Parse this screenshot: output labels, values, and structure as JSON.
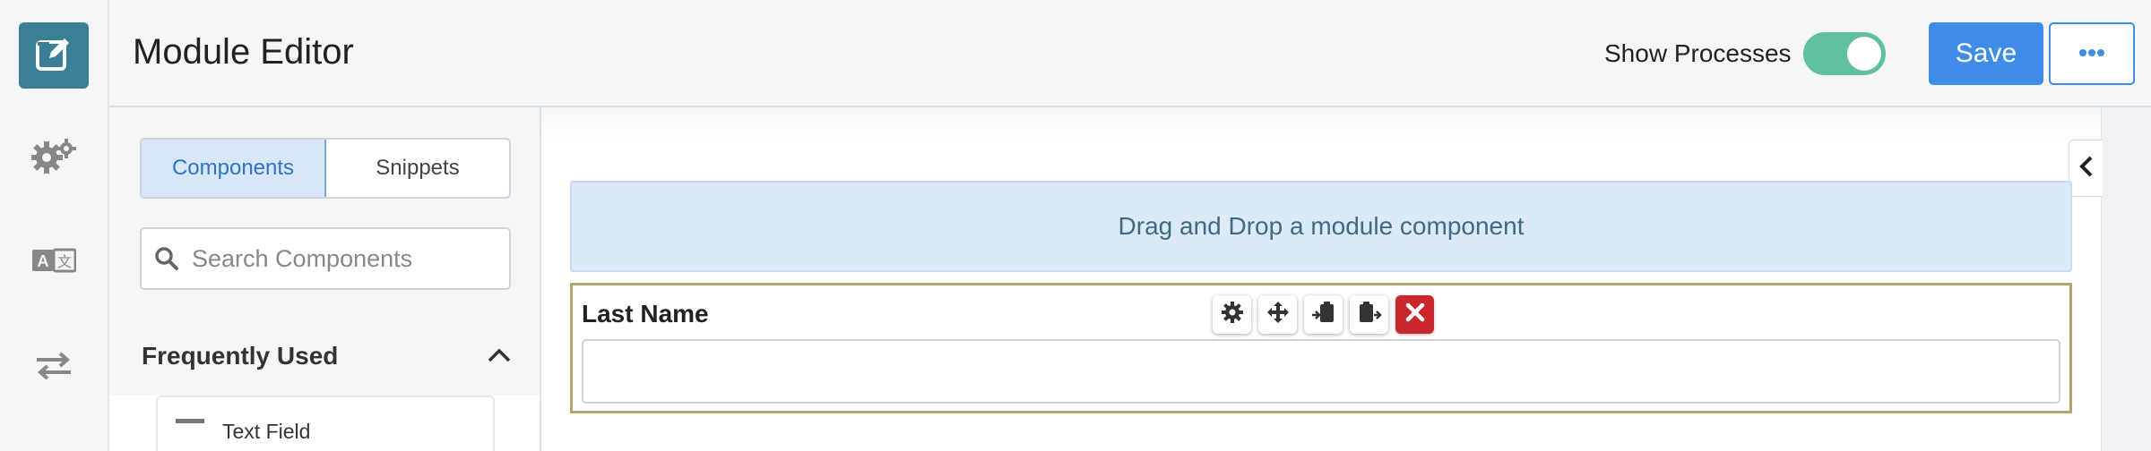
{
  "header": {
    "title": "Module Editor",
    "show_processes_label": "Show Processes",
    "show_processes_on": true,
    "save_label": "Save"
  },
  "rail": {
    "items": [
      {
        "icon": "edit-icon",
        "active": true
      },
      {
        "icon": "gears-icon"
      },
      {
        "icon": "translate-icon"
      },
      {
        "icon": "swap-arrows-icon"
      }
    ]
  },
  "panel": {
    "tabs": [
      {
        "label": "Components",
        "active": true
      },
      {
        "label": "Snippets"
      }
    ],
    "search_placeholder": "Search Components",
    "section_title": "Frequently Used",
    "items": [
      {
        "label": "Text Field",
        "icon": "dash-icon"
      }
    ]
  },
  "canvas": {
    "dropzone_text": "Drag and Drop a module component",
    "field": {
      "label": "Last Name",
      "value": ""
    },
    "field_toolbar": [
      "gear-icon",
      "move-icon",
      "paste-before-icon",
      "paste-after-icon",
      "delete-icon"
    ]
  },
  "colors": {
    "accent": "#3e8ce8",
    "rail_active": "#3a7f96",
    "toggle_on": "#5fbf9f",
    "selected_border": "#b5a46c",
    "dropzone_bg": "#dce9f7",
    "delete": "#c9272c"
  }
}
